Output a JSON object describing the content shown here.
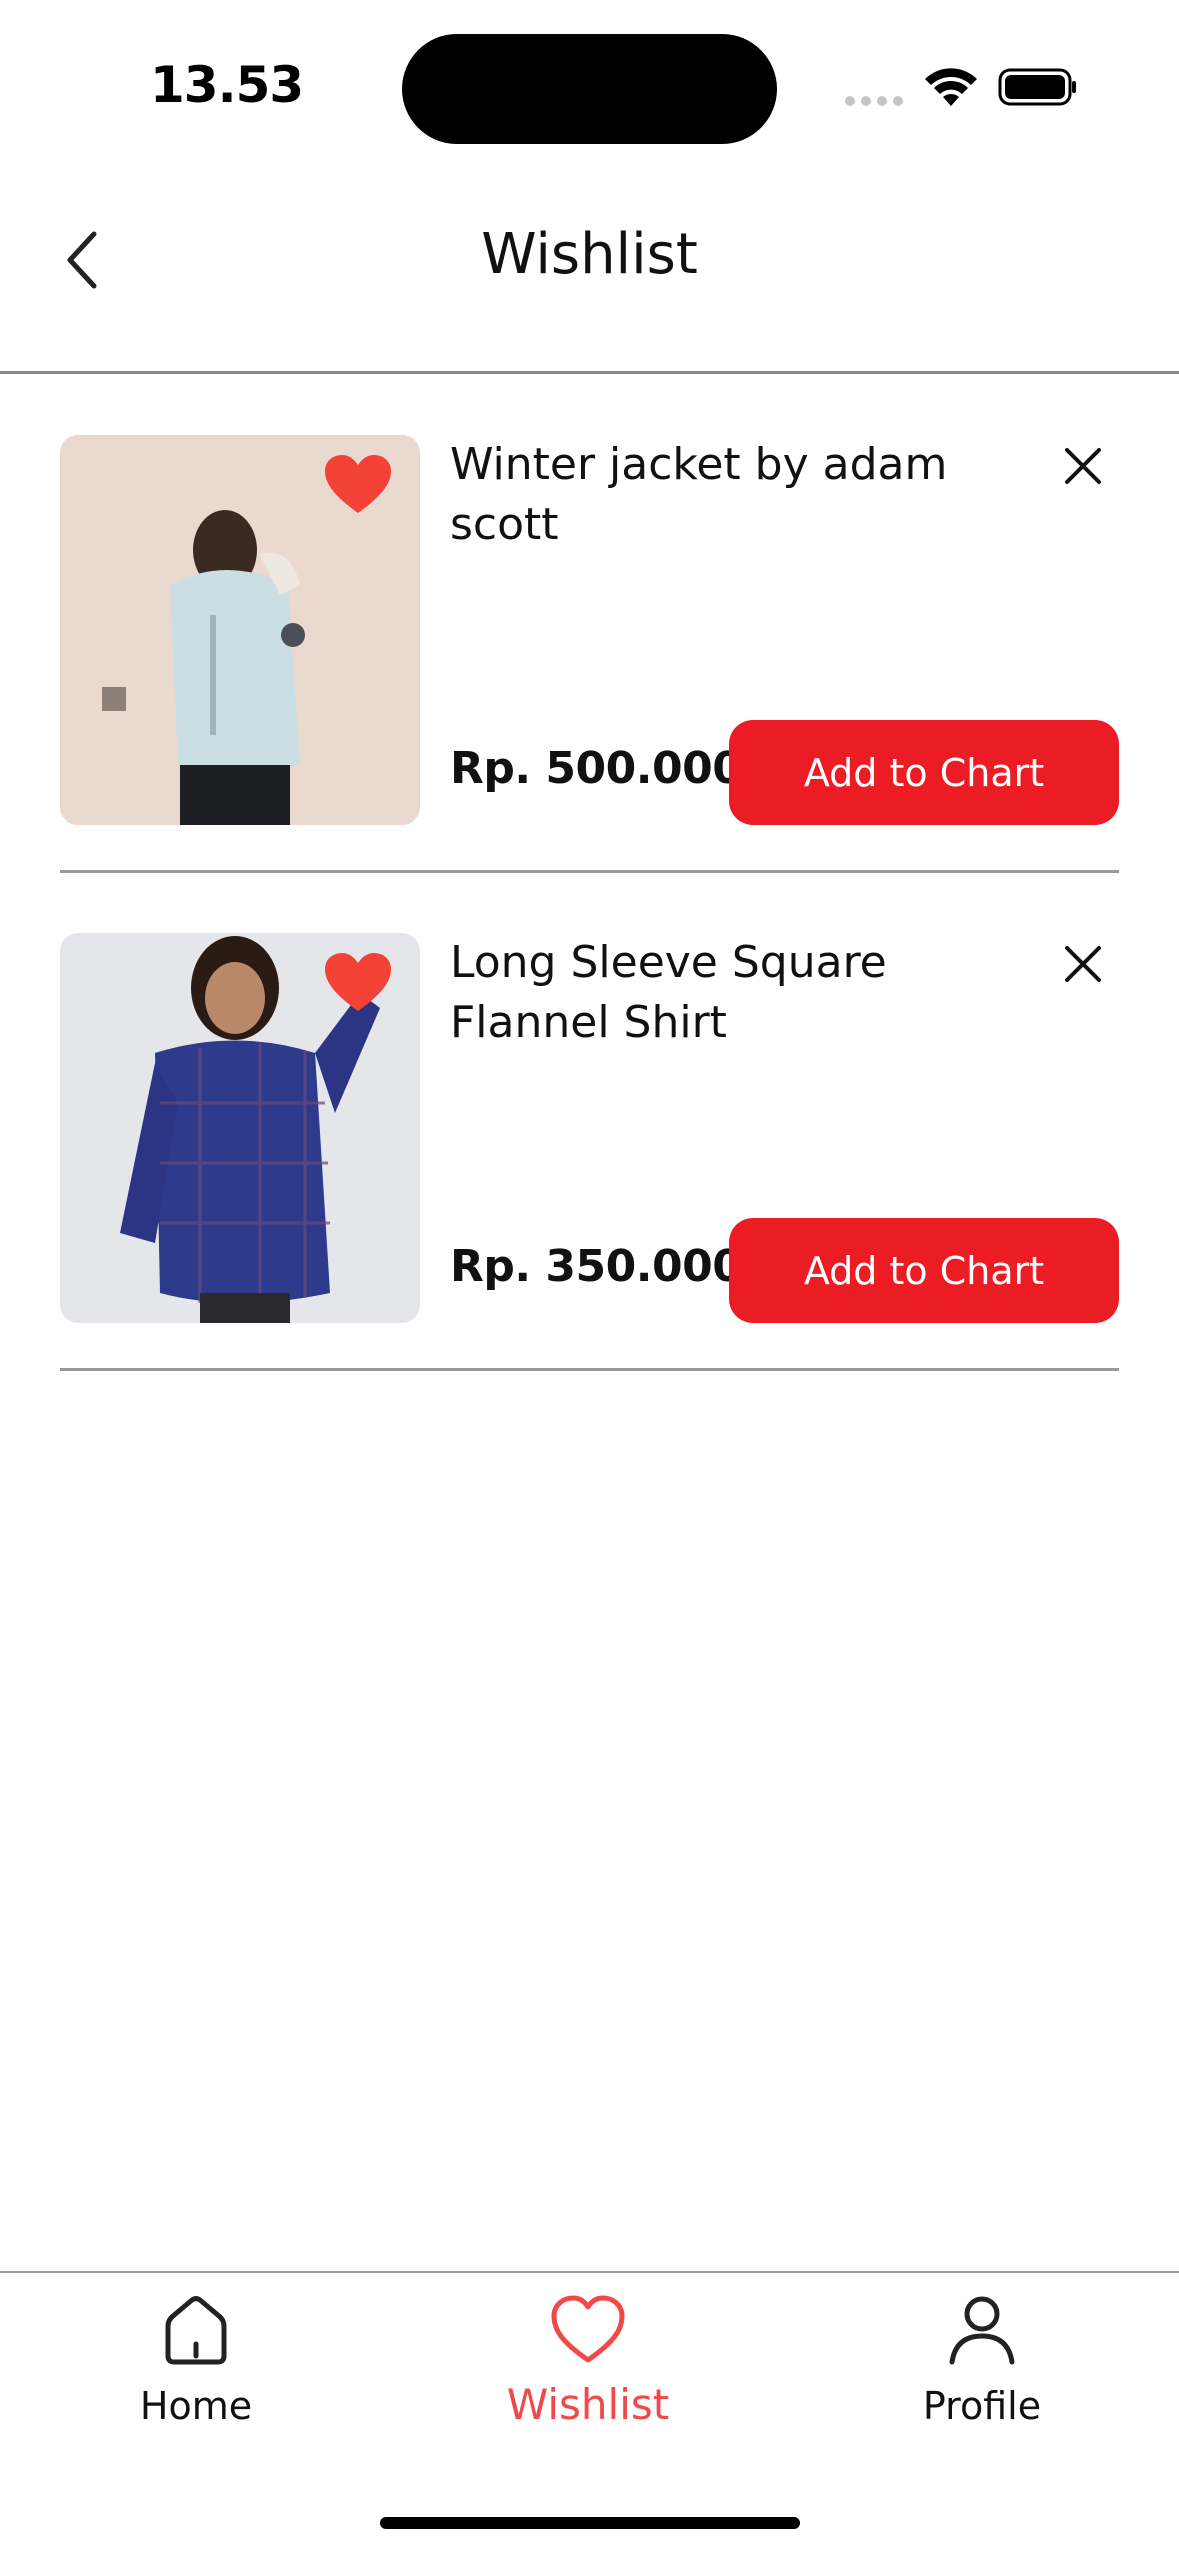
{
  "status_bar": {
    "time": "13.53"
  },
  "header": {
    "title": "Wishlist",
    "back_icon": "chevron-left-icon"
  },
  "colors": {
    "accent": "#ec1c24",
    "heart": "#f44336",
    "active_nav": "#ef4a48"
  },
  "items": [
    {
      "title": "Winter jacket by adam scott",
      "price": "Rp. 500.000",
      "button_label": "Add to Chart",
      "favorite": true,
      "image": "man-in-light-blue-winter-jacket"
    },
    {
      "title": "Long Sleeve Square Flannel Shirt",
      "price": "Rp. 350.000",
      "button_label": "Add to Chart",
      "favorite": true,
      "image": "woman-in-blue-plaid-flannel-shirt"
    }
  ],
  "nav": {
    "items": [
      {
        "label": "Home",
        "icon": "home-icon",
        "active": false
      },
      {
        "label": "Wishlist",
        "icon": "heart-icon",
        "active": true
      },
      {
        "label": "Profile",
        "icon": "user-icon",
        "active": false
      }
    ]
  }
}
